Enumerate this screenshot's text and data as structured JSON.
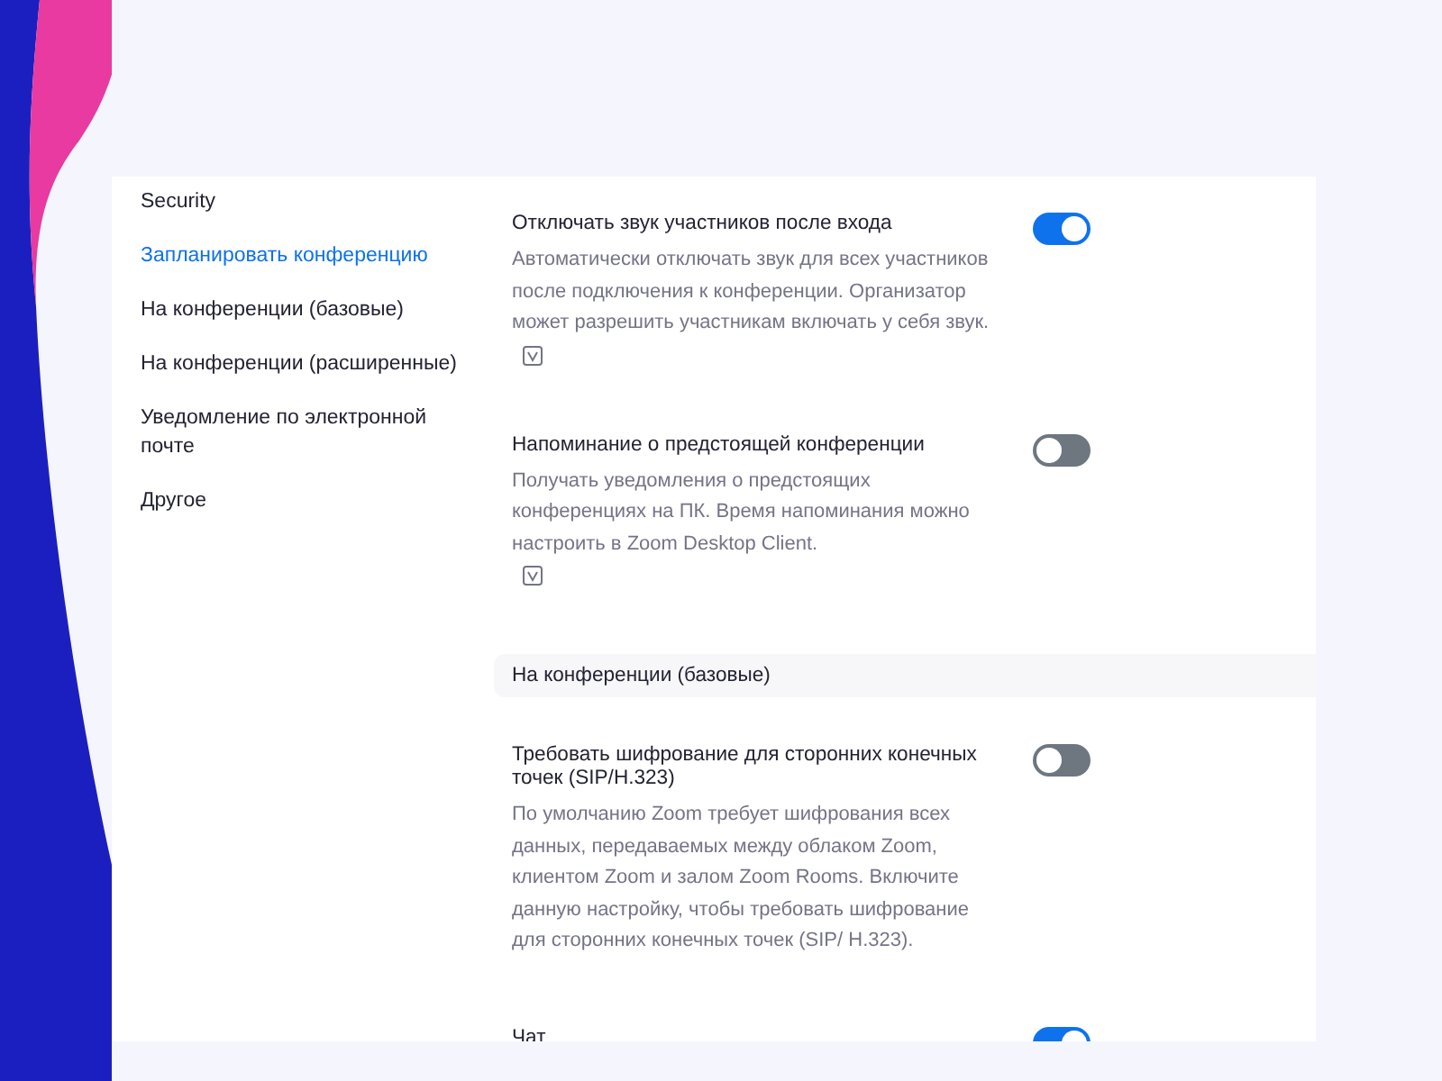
{
  "sidebar": {
    "items": [
      {
        "label": "Security",
        "selected": false
      },
      {
        "label": "Запланировать конференцию",
        "selected": true
      },
      {
        "label": "На конференции (базовые)",
        "selected": false
      },
      {
        "label": "На конференции (расширенные)",
        "selected": false
      },
      {
        "label": "Уведомление по электронной почте",
        "selected": false
      },
      {
        "label": "Другое",
        "selected": false
      }
    ]
  },
  "settings": [
    {
      "kind": "toggle",
      "title": "Отключать звук участников после входа",
      "description": "Автоматически отключать звук для всех участников после подключения к конференции. Организатор может разрешить участникам включать у себя звук.",
      "on": true,
      "tagged": true
    },
    {
      "kind": "toggle",
      "title": "Напоминание о предстоящей конференции",
      "description": "Получать уведомления о предстоящих конференциях на ПК. Время напоминания можно настроить в Zoom Desktop Client.",
      "on": false,
      "tagged": true
    },
    {
      "kind": "section",
      "title": "На конференции (базовые)"
    },
    {
      "kind": "toggle",
      "title": "Требовать шифрование для сторонних конечных точек (SIP/H.323)",
      "description": "По умолчанию Zoom требует шифрования всех данных, передаваемых между облаком Zoom, клиентом Zoom и залом Zoom Rooms. Включите данную настройку, чтобы требовать шифрование для сторонних конечных точек (SIP/ H.323).",
      "on": false,
      "tagged": false
    },
    {
      "kind": "toggle",
      "title": "Чат",
      "on": true,
      "tagged": false
    }
  ]
}
